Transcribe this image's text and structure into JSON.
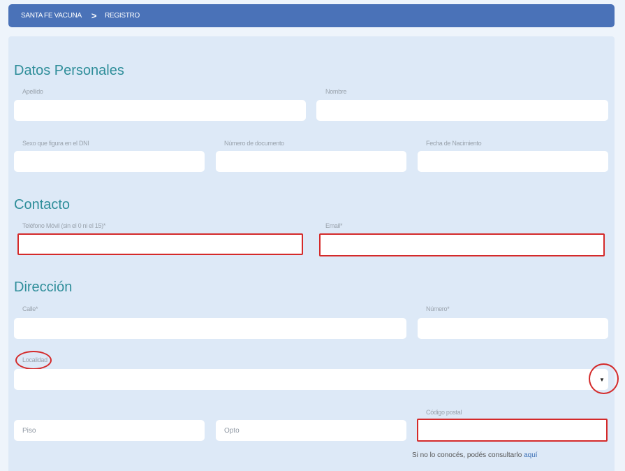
{
  "breadcrumb": {
    "home": "SANTA FE VACUNA",
    "separator": ">",
    "current": "REGISTRO"
  },
  "sections": {
    "personal": {
      "title": "Datos Personales",
      "apellido_label": "Apellido",
      "nombre_label": "Nombre",
      "sexo_label": "Sexo que figura en el DNI",
      "documento_label": "Número de documento",
      "nacimiento_label": "Fecha de Nacimiento"
    },
    "contacto": {
      "title": "Contacto",
      "telefono_label": "Teléfono Móvil (sin el 0 ni el 15)*",
      "email_label": "Email*"
    },
    "direccion": {
      "title": "Dirección",
      "calle_label": "Calle*",
      "numero_label": "Número*",
      "localidad_label": "Localidad",
      "piso_placeholder": "Piso",
      "opto_placeholder": "Opto",
      "codigo_postal_label": "Código postal",
      "hint_text": "Si no lo conocés, podés consultarlo ",
      "hint_link": "aquí"
    }
  },
  "icons": {
    "select_arrow": "caret-down-icon",
    "breadcrumb_separator": "chevron-right-icon"
  },
  "colors": {
    "header": "#4a72b8",
    "section_title": "#2f8e9a",
    "highlight": "#d42a2a",
    "link": "#3b6fb5"
  }
}
